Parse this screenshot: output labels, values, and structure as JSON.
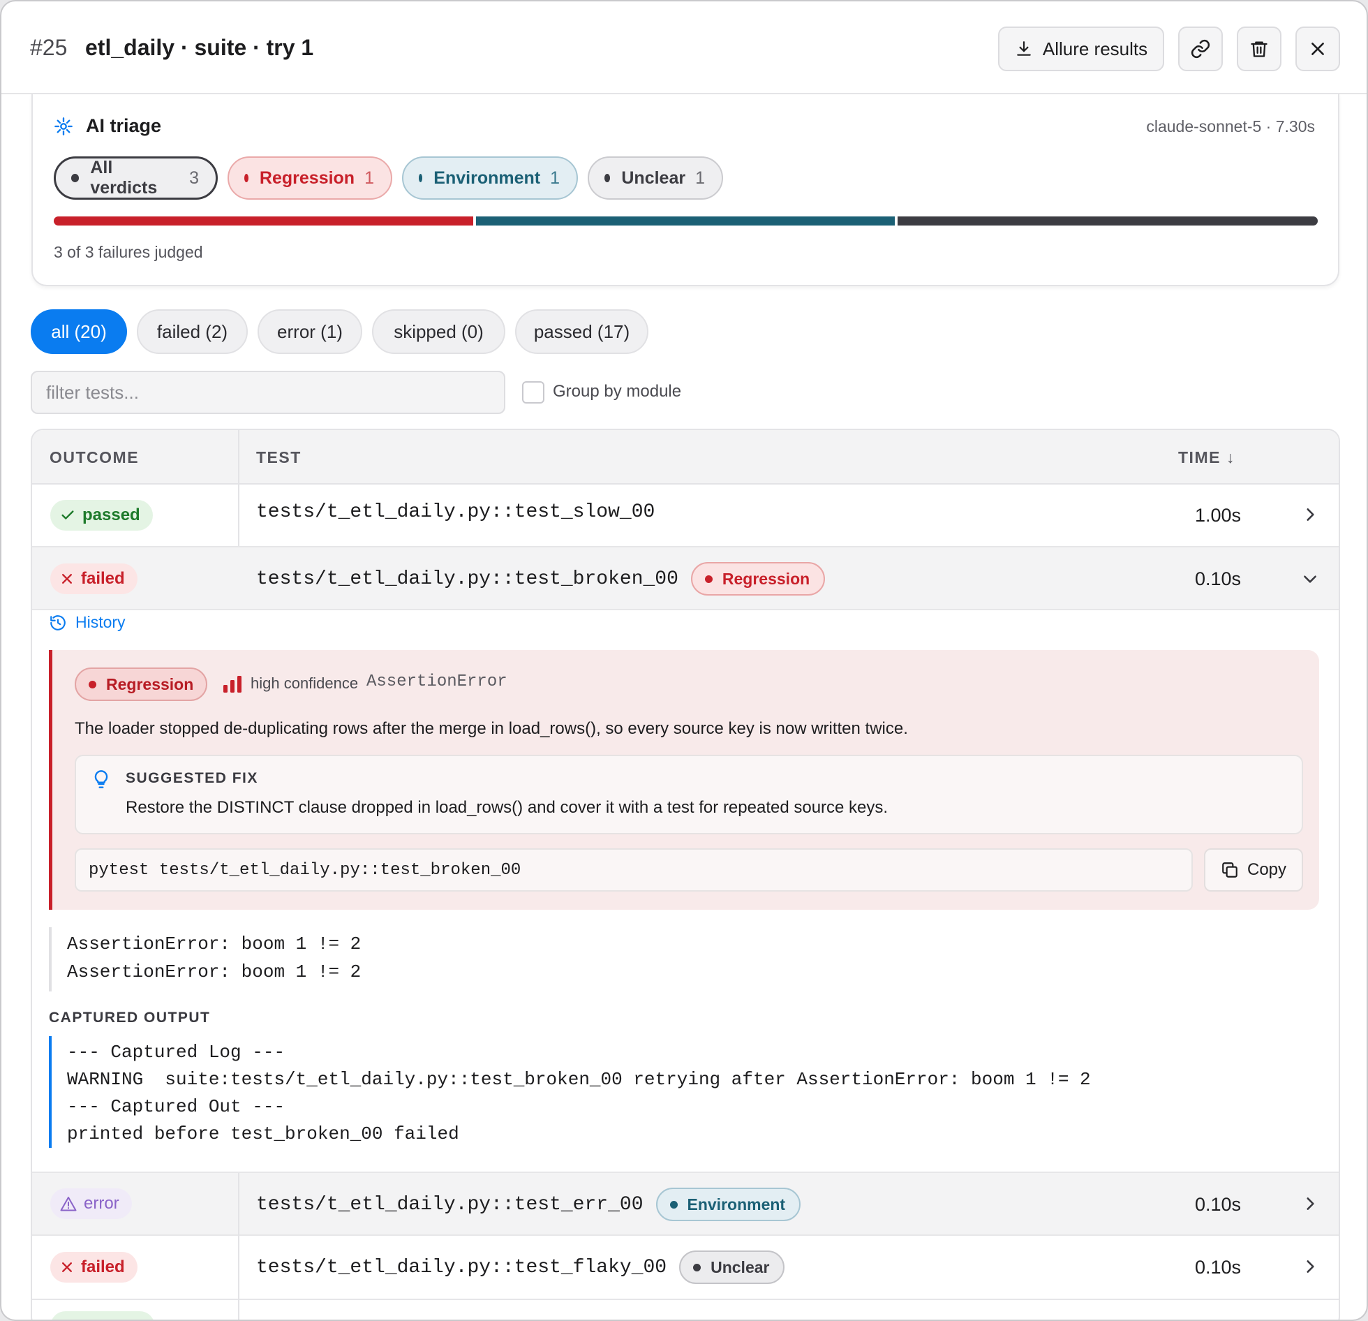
{
  "header": {
    "number": "#25",
    "title": "etl_daily · suite · try 1",
    "allure_label": "Allure results"
  },
  "triage": {
    "title": "AI triage",
    "meta": "claude-sonnet-5 · 7.30s",
    "verdicts": [
      {
        "label": "All verdicts",
        "count": "3"
      },
      {
        "label": "Regression",
        "count": "1"
      },
      {
        "label": "Environment",
        "count": "1"
      },
      {
        "label": "Unclear",
        "count": "1"
      }
    ],
    "distribution": {
      "regression": 1,
      "environment": 1,
      "unclear": 1
    },
    "judged": "3 of 3 failures judged"
  },
  "filters": [
    "all (20)",
    "failed (2)",
    "error (1)",
    "skipped (0)",
    "passed (17)"
  ],
  "search": {
    "placeholder": "filter tests..."
  },
  "group_by": "Group by module",
  "table": {
    "headers": {
      "outcome": "OUTCOME",
      "test": "TEST",
      "time": "TIME ↓"
    },
    "rows": [
      {
        "outcome": "passed",
        "test": "tests/t_etl_daily.py::test_slow_00",
        "verdict": "",
        "time": "1.00s"
      },
      {
        "outcome": "failed",
        "test": "tests/t_etl_daily.py::test_broken_00",
        "verdict": "Regression",
        "time": "0.10s"
      },
      {
        "outcome": "error",
        "test": "tests/t_etl_daily.py::test_err_00",
        "verdict": "Environment",
        "time": "0.10s"
      },
      {
        "outcome": "failed",
        "test": "tests/t_etl_daily.py::test_flaky_00",
        "verdict": "Unclear",
        "time": "0.10s"
      }
    ]
  },
  "expanded": {
    "history_label": "History",
    "verdict": "Regression",
    "confidence": "high confidence",
    "error_type": "AssertionError",
    "summary": "The loader stopped de-duplicating rows after the merge in load_rows(), so every source key is now written twice.",
    "fix_title": "SUGGESTED FIX",
    "fix_text": "Restore the DISTINCT clause dropped in load_rows() and cover it with a test for repeated source keys.",
    "command": "pytest tests/t_etl_daily.py::test_broken_00",
    "copy_label": "Copy",
    "trace": [
      "AssertionError: boom 1 != 2",
      "AssertionError: boom 1 != 2"
    ],
    "captured_title": "CAPTURED OUTPUT",
    "captured": [
      "--- Captured Log ---",
      "WARNING  suite:tests/t_etl_daily.py::test_broken_00 retrying after AssertionError: boom 1 != 2",
      "--- Captured Out ---",
      "printed before test_broken_00 failed"
    ]
  },
  "colors": {
    "accent": "#0a7cf0",
    "regression": "#c8202a",
    "environment": "#1b6075",
    "unclear": "#3c3c42",
    "passed": "#1d7a2a",
    "error": "#8a63c8"
  }
}
